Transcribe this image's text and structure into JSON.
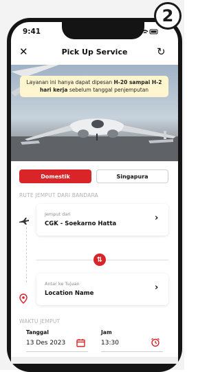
{
  "step_badge": "2",
  "status_bar": {
    "time": "9:41",
    "icons": "signal wifi battery"
  },
  "nav": {
    "title": "Pick Up Service",
    "close_icon": "close-icon",
    "refresh_icon": "refresh-icon"
  },
  "notice": {
    "text_start": "Layanan ini hanya dapat dipesan ",
    "bold1": "H-20 sampai H-2 hari kerja",
    "text_end": " sebelum tanggal penjemputan"
  },
  "tabs": [
    {
      "label": "Domestik",
      "active": true
    },
    {
      "label": "Singapura",
      "active": false
    }
  ],
  "route": {
    "section_label": "RUTE JEMPUT DARI BANDARA",
    "pickup": {
      "caption": "Jemput dari",
      "value": "CGK - Soekarno Hatta"
    },
    "destination": {
      "caption": "Antar ke Tujuan",
      "value": "Location Name"
    }
  },
  "schedule": {
    "section_label": "WAKTU JEMPUT",
    "date": {
      "label": "Tanggal",
      "value": "13 Des 2023"
    },
    "time": {
      "label": "Jam",
      "value": "13:30"
    }
  },
  "colors": {
    "accent": "#d9252a",
    "notice_bg": "#fff5cf"
  }
}
